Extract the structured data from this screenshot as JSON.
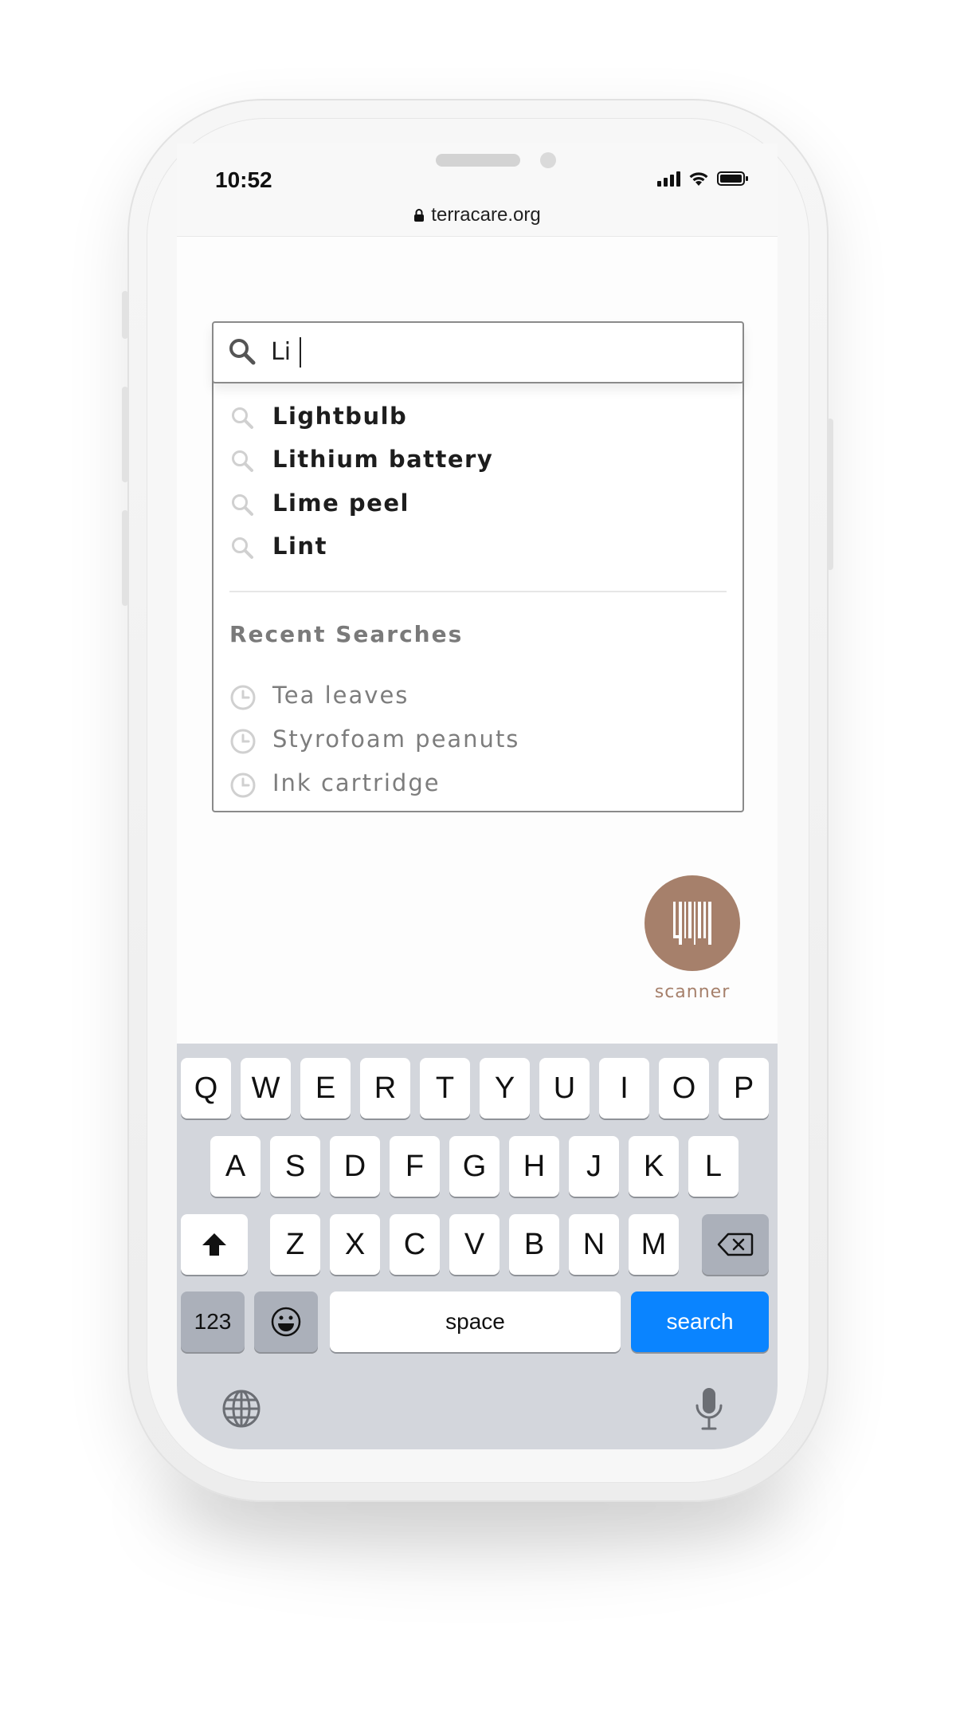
{
  "status_bar": {
    "time": "10:52",
    "icons": [
      "signal-icon",
      "wifi-icon",
      "battery-icon"
    ]
  },
  "browser": {
    "url": "terracare.org",
    "lock_icon": "lock-icon"
  },
  "search": {
    "value": "Li",
    "icon": "search-icon",
    "suggestions": [
      {
        "label": "Lightbulb"
      },
      {
        "label": "Lithium battery"
      },
      {
        "label": "Lime peel"
      },
      {
        "label": "Lint"
      }
    ],
    "recent_title": "Recent Searches",
    "recent": [
      {
        "label": "Tea leaves"
      },
      {
        "label": "Styrofoam peanuts"
      },
      {
        "label": "Ink cartridge"
      }
    ]
  },
  "scanner": {
    "label": "scanner",
    "icon": "barcode-icon",
    "color": "#a6806b"
  },
  "keyboard": {
    "row1": [
      "Q",
      "W",
      "E",
      "R",
      "T",
      "Y",
      "U",
      "I",
      "O",
      "P"
    ],
    "row2": [
      "A",
      "S",
      "D",
      "F",
      "G",
      "H",
      "J",
      "K",
      "L"
    ],
    "row3": [
      "Z",
      "X",
      "C",
      "V",
      "B",
      "N",
      "M"
    ],
    "numbers_key": "123",
    "space_key": "space",
    "search_key": "search",
    "search_key_color": "#0a84ff",
    "icons": [
      "shift-icon",
      "backspace-icon",
      "emoji-icon",
      "globe-icon",
      "microphone-icon"
    ]
  }
}
